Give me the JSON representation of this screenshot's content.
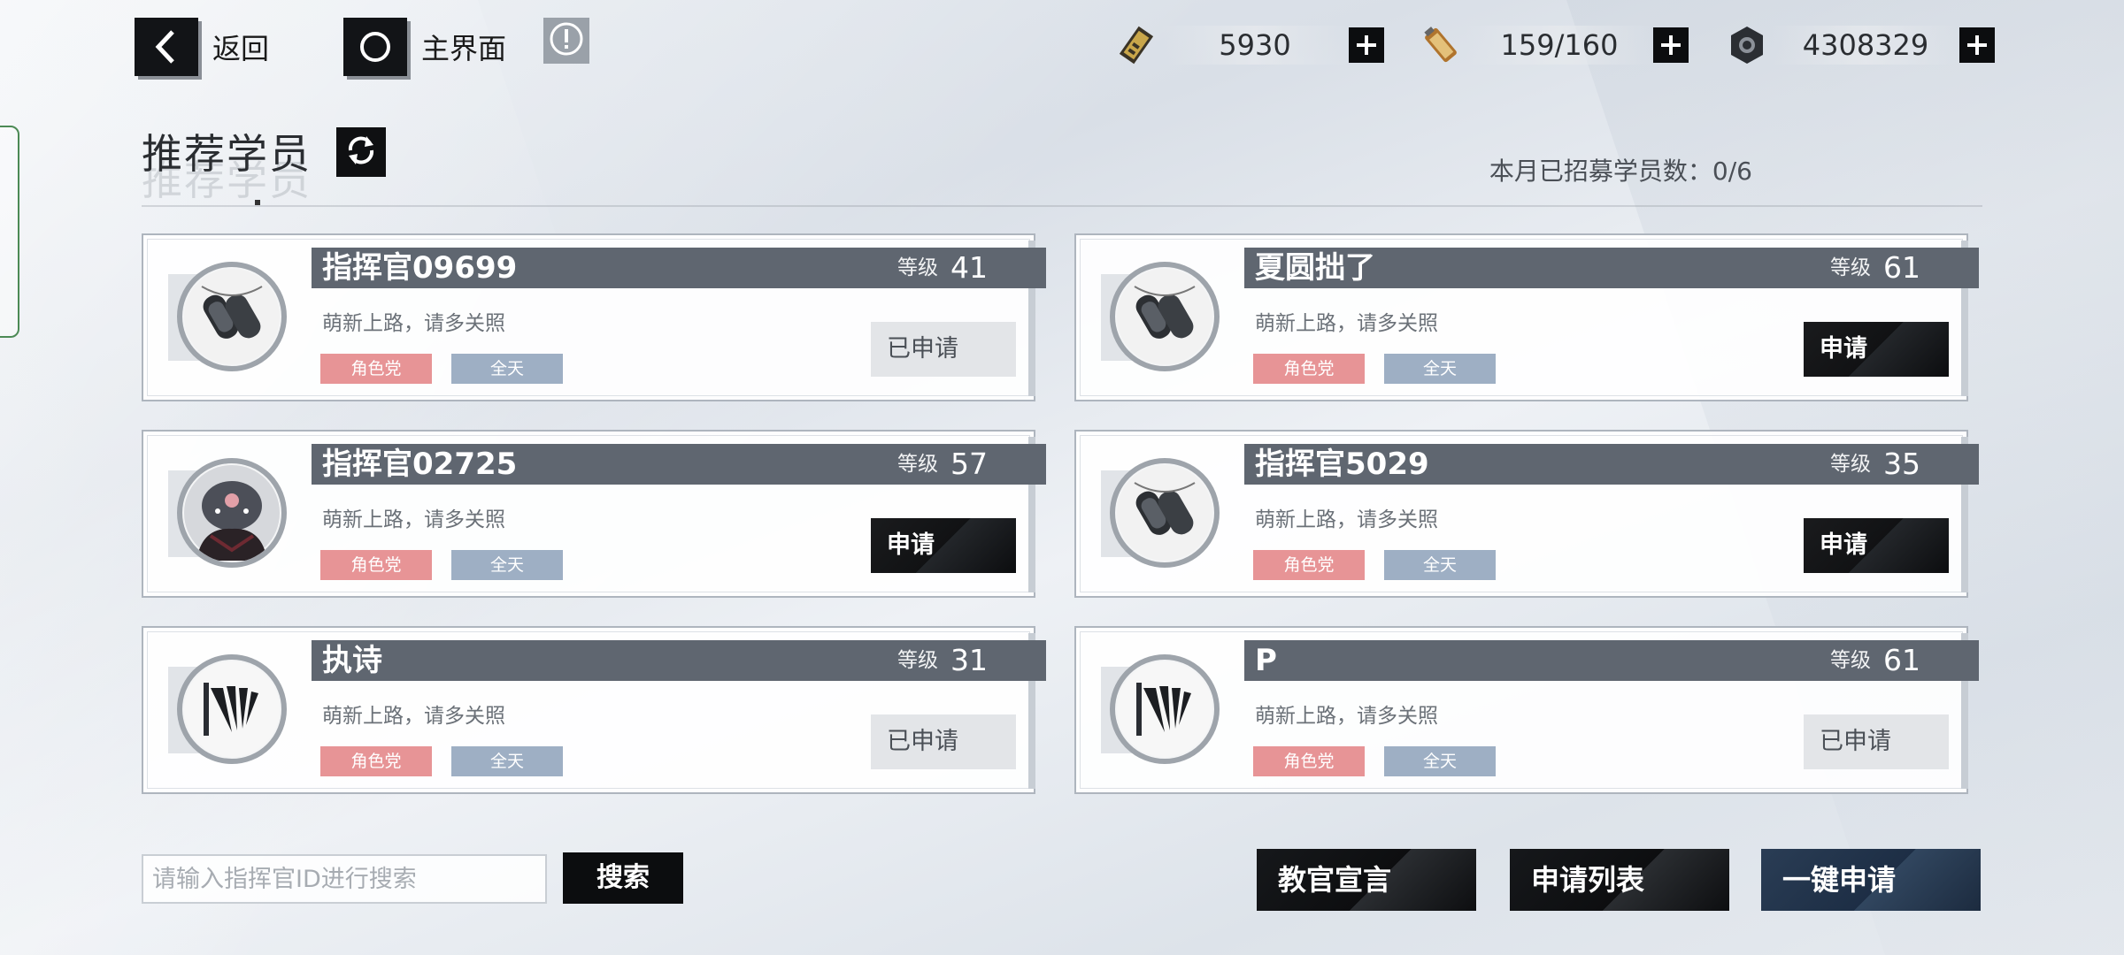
{
  "nav": {
    "back_label": "返回",
    "home_label": "主界面",
    "back_icon": "chevron-left-icon",
    "home_icon": "circle-icon",
    "alert_icon": "exclamation-icon"
  },
  "resources": [
    {
      "icon": "ticket-icon",
      "value": "5930"
    },
    {
      "icon": "battery-icon",
      "value": "159/160"
    },
    {
      "icon": "nut-icon",
      "value": "4308329"
    }
  ],
  "section": {
    "title": "推荐学员",
    "month_count": "本月已招募学员数：0/6"
  },
  "cards": [
    {
      "name": "指挥官09699",
      "level_label": "等级",
      "level": "41",
      "motto": "萌新上路，请多关照",
      "tags": [
        "角色党",
        "全天"
      ],
      "button": "已申请",
      "state": "applied",
      "avatar": "dogtag"
    },
    {
      "name": "夏圆拙了",
      "level_label": "等级",
      "level": "61",
      "motto": "萌新上路，请多关照",
      "tags": [
        "角色党",
        "全天"
      ],
      "button": "申请",
      "state": "active",
      "avatar": "dogtag"
    },
    {
      "name": "指挥官02725",
      "level_label": "等级",
      "level": "57",
      "motto": "萌新上路，请多关照",
      "tags": [
        "角色党",
        "全天"
      ],
      "button": "申请",
      "state": "active",
      "avatar": "character"
    },
    {
      "name": "指挥官5029",
      "level_label": "等级",
      "level": "35",
      "motto": "萌新上路，请多关照",
      "tags": [
        "角色党",
        "全天"
      ],
      "button": "申请",
      "state": "active",
      "avatar": "dogtag"
    },
    {
      "name": "执诗",
      "level_label": "等级",
      "level": "31",
      "motto": "萌新上路，请多关照",
      "tags": [
        "角色党",
        "全天"
      ],
      "button": "已申请",
      "state": "applied",
      "avatar": "emblem"
    },
    {
      "name": "P",
      "level_label": "等级",
      "level": "61",
      "motto": "萌新上路，请多关照",
      "tags": [
        "角色党",
        "全天"
      ],
      "button": "已申请",
      "state": "applied",
      "avatar": "emblem"
    }
  ],
  "search": {
    "placeholder": "请输入指挥官ID进行搜索",
    "value": "",
    "button": "搜索"
  },
  "actions": {
    "declaration": "教官宣言",
    "apply_list": "申请列表",
    "one_click_apply": "一键申请"
  },
  "colors": {
    "name_bar": "#5f6670",
    "tag_role": "#e79496",
    "tag_time": "#9eafc4",
    "primary_button": "#1d2e45"
  }
}
